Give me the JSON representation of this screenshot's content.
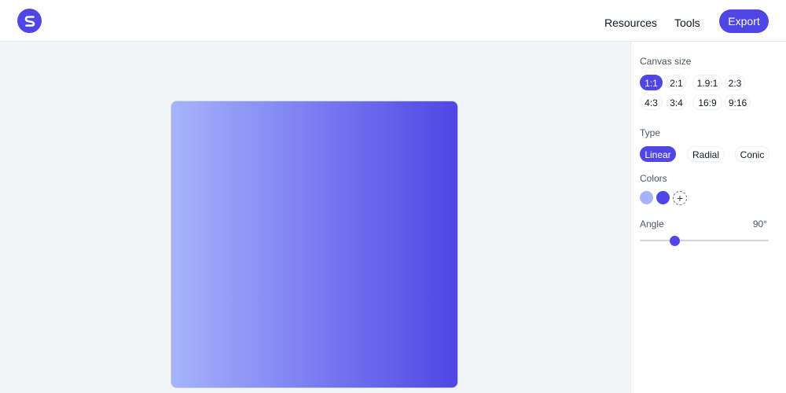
{
  "header": {
    "logo_icon": "s-logo-icon",
    "nav": {
      "resources": "Resources",
      "tools": "Tools"
    },
    "export_label": "Export"
  },
  "canvas": {
    "gradient_type": "linear",
    "angle": 90,
    "colors": [
      "#a5b4fc",
      "#4f46e5"
    ]
  },
  "sidebar": {
    "canvas_size": {
      "label": "Canvas size",
      "selected": "1:1",
      "options": [
        "1:1",
        "2:1",
        "1.9:1",
        "2:3",
        "4:3",
        "3:4",
        "16:9",
        "9:16"
      ]
    },
    "type": {
      "label": "Type",
      "selected": "Linear",
      "options": [
        "Linear",
        "Radial",
        "Conic"
      ]
    },
    "colors": {
      "label": "Colors",
      "swatches": [
        "#a5b4fc",
        "#4f46e5"
      ],
      "add_label": "+"
    },
    "angle": {
      "label": "Angle",
      "value_text": "90°",
      "value": 90,
      "min": 0,
      "max": 360
    }
  },
  "theme": {
    "accent": "#4f46e5"
  }
}
